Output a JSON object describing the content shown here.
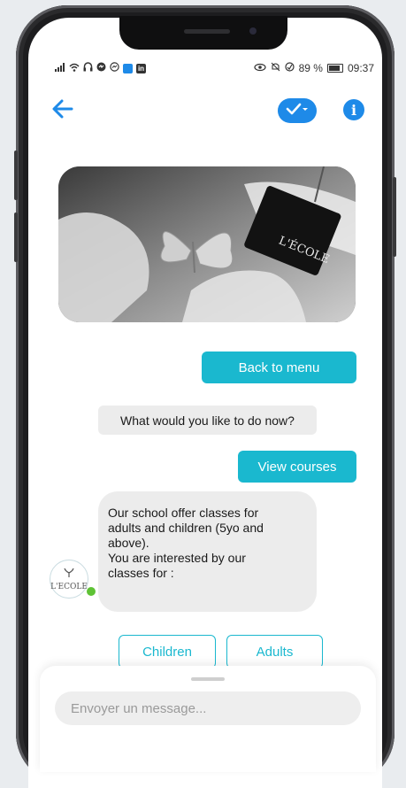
{
  "status_bar": {
    "left_icons": [
      "signal-icon",
      "wifi-icon",
      "headset-icon",
      "messenger-icon",
      "app-icon",
      "linkedin-icon"
    ],
    "battery": "89 %",
    "time": "09:37"
  },
  "header": {
    "back_icon": "back-arrow-icon",
    "check_icon": "check-dropdown-icon",
    "info_icon": "i"
  },
  "photo": {
    "badge_text": "L'ÉCOLE"
  },
  "conversation": {
    "user_msg_1": "Back to menu",
    "bot_msg_1": "What would you like to do now?",
    "user_msg_2": "View courses",
    "bot_msg_2_lines": [
      "Our school offer classes for",
      "adults and children (5yo and",
      "above).",
      "You are interested by our",
      "classes for :"
    ]
  },
  "avatar": {
    "label": "L'ECOLE"
  },
  "choices": {
    "children": "Children",
    "adults": "Adults"
  },
  "composer": {
    "placeholder": "Envoyer un message..."
  },
  "colors": {
    "accent": "#1ab8cf",
    "blue": "#1e8ae8",
    "bot_bubble": "#ececec",
    "online": "#5ec235"
  }
}
